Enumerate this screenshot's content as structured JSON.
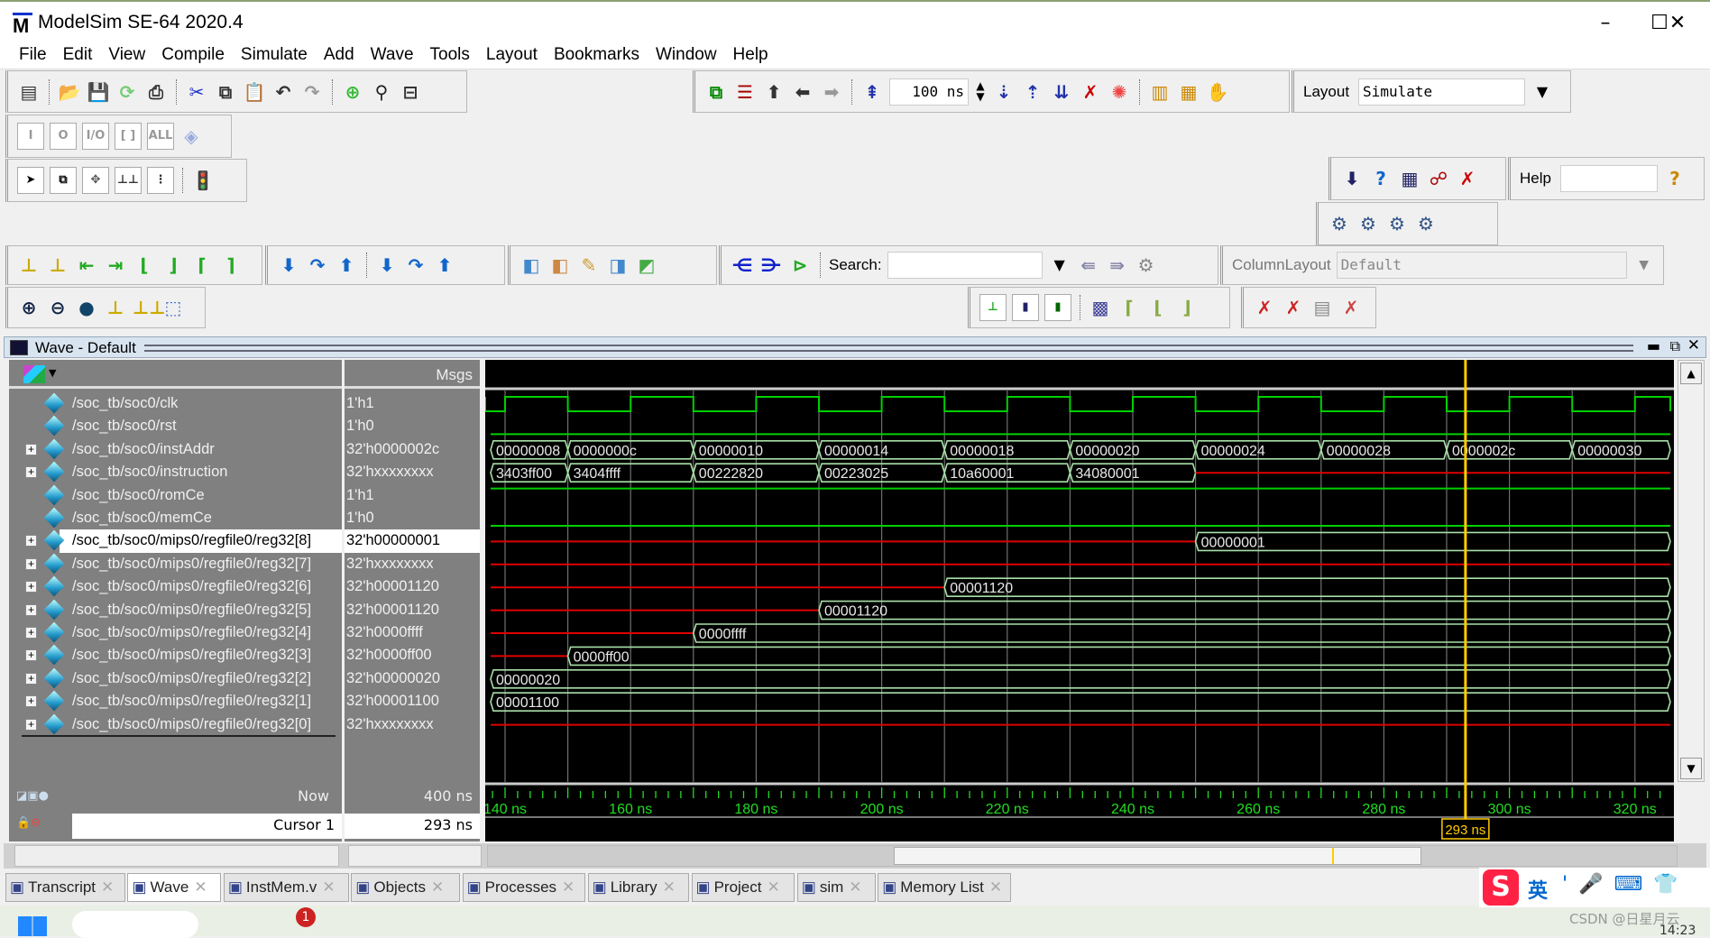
{
  "window": {
    "title": "ModelSim SE-64 2020.4",
    "logo": "M",
    "minimize": "–",
    "maximize": "☐",
    "close": "✕"
  },
  "menu": [
    "File",
    "Edit",
    "View",
    "Compile",
    "Simulate",
    "Add",
    "Wave",
    "Tools",
    "Layout",
    "Bookmarks",
    "Window",
    "Help"
  ],
  "toolbar": {
    "run_length": "100 ns",
    "layout_label": "Layout",
    "layout_value": "Simulate",
    "help_label": "Help",
    "help_value": "",
    "search_label": "Search:",
    "search_value": "",
    "column_layout_label": "ColumnLayout",
    "column_layout_value": "Default"
  },
  "toolbar_groups": {
    "tb-file": [
      "new-file-icon",
      "sep",
      "open-folder-icon",
      "save-icon",
      "reload-icon",
      "print-icon",
      "sep",
      "cut-icon",
      "copy-icon",
      "paste-icon",
      "undo-icon",
      "redo-icon",
      "sep",
      "add-icon",
      "find-binoculars-icon",
      "collapse-icon"
    ],
    "tb-compile": [
      "compile-icon",
      "compile-all-icon",
      "up-arrow-icon",
      "back-arrow-icon",
      "forward-arrow-icon",
      "sep",
      "restart-icon"
    ],
    "tb-run": [
      "run-icon",
      "continue-icon",
      "run-all-icon",
      "break-icon",
      "stop-icon",
      "sep",
      "performance-icon",
      "memory-profile-icon",
      "hand-icon"
    ],
    "tb-objfilter": [
      "input-filter-icon",
      "output-filter-icon",
      "inout-filter-icon",
      "internal-filter-icon",
      "all-filter-icon",
      "filter-settings-icon"
    ],
    "tb-mouse": [
      "select-mode-icon",
      "zoom-mode-icon",
      "pan-mode-icon",
      "edit-mode-icon",
      "split-mode-icon",
      "sep",
      "traffic-light-icon"
    ],
    "tb-step": [
      "step-into-icon",
      "step-over-icon",
      "step-out-icon",
      "sep",
      "step-into-all-icon",
      "step-over-all-icon",
      "step-out-all-icon"
    ],
    "tb-rightA": [
      "load-dataset-icon",
      "help-doc-icon",
      "list-icon",
      "debug-icon",
      "close-dataset-icon"
    ],
    "tb-gears": [
      "gear-red-icon",
      "gear-yellow-icon",
      "gear-warning-icon",
      "gear-green-icon"
    ],
    "tb-cursor": [
      "insert-cursor-icon",
      "delete-cursor-icon",
      "prev-edge-icon",
      "next-edge-icon",
      "prev-falling-icon",
      "next-falling-icon",
      "prev-rising-icon",
      "next-rising-icon"
    ],
    "tb-wave-edit": [
      "add-wave-icon",
      "remove-wave-icon",
      "edit-wave-icon",
      "save-wave-icon",
      "export-wave-icon"
    ],
    "tb-dataflow": [
      "trace-back-icon",
      "trace-forward-icon",
      "trace-x-icon",
      "sep"
    ],
    "tb-zoom": [
      "zoom-in-icon",
      "zoom-out-icon",
      "zoom-full-icon",
      "zoom-cursor-icon",
      "zoom-between-cursors-icon",
      "zoom-area-icon"
    ],
    "tb-style": [
      "style-line-icon",
      "style-bar-icon",
      "style-box-icon",
      "sep",
      "style-dense-icon",
      "style-step-icon",
      "style-edge-icon",
      "style-edge2-icon"
    ],
    "tb-cursorx": [
      "delete-cursor-left-icon",
      "delete-cursor-right-icon",
      "lock-cursor-icon",
      "remove-cursor-icon"
    ]
  },
  "wave": {
    "title": "Wave - Default",
    "msgs_header": "Msgs",
    "signals": [
      {
        "name": "/soc_tb/soc0/clk",
        "value": "1'h1",
        "type": "clock",
        "period_ns": 20,
        "first_rise_ns": 150,
        "expandable": false
      },
      {
        "name": "/soc_tb/soc0/rst",
        "value": "1'h0",
        "type": "bit",
        "level": 0,
        "expandable": false
      },
      {
        "name": "/soc_tb/soc0/instAddr",
        "value": "32'h0000002c",
        "type": "bus",
        "expandable": true,
        "segments": [
          {
            "from": 130,
            "v": "00000008"
          },
          {
            "from": 150,
            "v": "0000000c"
          },
          {
            "from": 170,
            "v": "00000010"
          },
          {
            "from": 190,
            "v": "00000014"
          },
          {
            "from": 210,
            "v": "00000018"
          },
          {
            "from": 230,
            "v": "00000020"
          },
          {
            "from": 250,
            "v": "00000024"
          },
          {
            "from": 270,
            "v": "00000028"
          },
          {
            "from": 290,
            "v": "0000002c"
          },
          {
            "from": 310,
            "v": "00000030"
          }
        ]
      },
      {
        "name": "/soc_tb/soc0/instruction",
        "value": "32'hxxxxxxxx",
        "type": "bus",
        "expandable": true,
        "segments": [
          {
            "from": 130,
            "v": "3403ff00"
          },
          {
            "from": 150,
            "v": "3404ffff"
          },
          {
            "from": 170,
            "v": "00222820"
          },
          {
            "from": 190,
            "v": "00223025"
          },
          {
            "from": 210,
            "v": "10a60001"
          },
          {
            "from": 230,
            "v": "34080001"
          },
          {
            "from": 250,
            "v": "x"
          }
        ]
      },
      {
        "name": "/soc_tb/soc0/romCe",
        "value": "1'h1",
        "type": "bit",
        "level": 1,
        "expandable": false
      },
      {
        "name": "/soc_tb/soc0/memCe",
        "value": "1'h0",
        "type": "bit",
        "level": 0,
        "expandable": false
      },
      {
        "name": "/soc_tb/soc0/mips0/regfile0/reg32[8]",
        "value": "32'h00000001",
        "type": "bus",
        "expandable": true,
        "selected": true,
        "segments": [
          {
            "from": 130,
            "v": "x"
          },
          {
            "from": 250,
            "v": "00000001"
          }
        ]
      },
      {
        "name": "/soc_tb/soc0/mips0/regfile0/reg32[7]",
        "value": "32'hxxxxxxxx",
        "type": "bus",
        "expandable": true,
        "segments": [
          {
            "from": 130,
            "v": "x"
          }
        ]
      },
      {
        "name": "/soc_tb/soc0/mips0/regfile0/reg32[6]",
        "value": "32'h00001120",
        "type": "bus",
        "expandable": true,
        "segments": [
          {
            "from": 130,
            "v": "x"
          },
          {
            "from": 210,
            "v": "00001120"
          }
        ]
      },
      {
        "name": "/soc_tb/soc0/mips0/regfile0/reg32[5]",
        "value": "32'h00001120",
        "type": "bus",
        "expandable": true,
        "segments": [
          {
            "from": 130,
            "v": "x"
          },
          {
            "from": 190,
            "v": "00001120"
          }
        ]
      },
      {
        "name": "/soc_tb/soc0/mips0/regfile0/reg32[4]",
        "value": "32'h0000ffff",
        "type": "bus",
        "expandable": true,
        "segments": [
          {
            "from": 130,
            "v": "x"
          },
          {
            "from": 170,
            "v": "0000ffff"
          }
        ]
      },
      {
        "name": "/soc_tb/soc0/mips0/regfile0/reg32[3]",
        "value": "32'h0000ff00",
        "type": "bus",
        "expandable": true,
        "segments": [
          {
            "from": 130,
            "v": "x"
          },
          {
            "from": 150,
            "v": "0000ff00"
          }
        ]
      },
      {
        "name": "/soc_tb/soc0/mips0/regfile0/reg32[2]",
        "value": "32'h00000020",
        "type": "bus",
        "expandable": true,
        "segments": [
          {
            "from": 130,
            "v": "00000020"
          }
        ]
      },
      {
        "name": "/soc_tb/soc0/mips0/regfile0/reg32[1]",
        "value": "32'h00001100",
        "type": "bus",
        "expandable": true,
        "segments": [
          {
            "from": 130,
            "v": "00001100"
          }
        ]
      },
      {
        "name": "/soc_tb/soc0/mips0/regfile0/reg32[0]",
        "value": "32'hxxxxxxxx",
        "type": "bus",
        "expandable": true,
        "segments": [
          {
            "from": 130,
            "v": "x"
          }
        ]
      }
    ],
    "time_axis": {
      "unit": "ns",
      "view_start_ns": 137,
      "view_end_ns": 326,
      "labels": [
        "140 ns",
        "160 ns",
        "180 ns",
        "200 ns",
        "220 ns",
        "240 ns",
        "260 ns",
        "280 ns",
        "300 ns",
        "320 ns"
      ]
    },
    "now_label": "Now",
    "now_value": "400 ns",
    "cursor_label": "Cursor 1",
    "cursor_value": "293 ns",
    "cursor_ns": 293,
    "cursor_tag": "293 ns",
    "colors": {
      "background": "#000000",
      "bit": "#00d000",
      "bus": "#a8e0a8",
      "unknown": "#e00000",
      "cursor": "#ffcc00",
      "grid": "#707070",
      "axis_text": "#22dd22"
    }
  },
  "tabs": [
    {
      "label": "Transcript",
      "icon": "transcript-icon"
    },
    {
      "label": "Wave",
      "icon": "wave-icon",
      "active": true
    },
    {
      "label": "InstMem.v",
      "icon": "source-file-icon"
    },
    {
      "label": "Objects",
      "icon": "objects-icon"
    },
    {
      "label": "Processes",
      "icon": "processes-icon"
    },
    {
      "label": "Library",
      "icon": "library-icon"
    },
    {
      "label": "Project",
      "icon": "project-icon"
    },
    {
      "label": "sim",
      "icon": "sim-icon"
    },
    {
      "label": "Memory List",
      "icon": "memory-list-icon"
    }
  ],
  "taskbar": {
    "ime_label": "英",
    "watermark": "CSDN @日星月云",
    "time": "14:23",
    "badge": "1"
  }
}
